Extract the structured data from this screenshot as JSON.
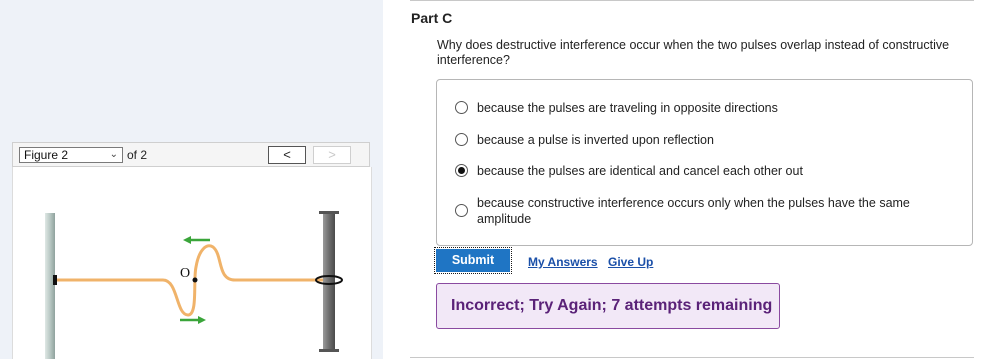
{
  "figure_panel": {
    "select_value": "Figure 2",
    "of_text": "of 2",
    "prev_label": "<",
    "next_label": ">",
    "origin_label": "O",
    "colors": {
      "string": "#f0b36a",
      "arrow": "#3aa53a",
      "wall": "#b9c8c4",
      "pole": "#6e6e6e"
    },
    "icons": {
      "arrow_left": "green-arrow-left-icon",
      "arrow_right": "green-arrow-right-icon"
    }
  },
  "part": {
    "title": "Part C",
    "question": "Why does destructive interference occur when the two pulses overlap instead of constructive interference?",
    "options": [
      {
        "label": "because the pulses are traveling in opposite directions",
        "selected": false
      },
      {
        "label": "because a pulse is inverted upon reflection",
        "selected": false
      },
      {
        "label": "because the pulses are identical and cancel each other out",
        "selected": true
      },
      {
        "label": "because constructive interference occurs only when the pulses have the same amplitude",
        "selected": false
      }
    ],
    "submit_label": "Submit",
    "my_answers_label": "My Answers",
    "give_up_label": "Give Up",
    "feedback": "Incorrect; Try Again; 7 attempts remaining"
  }
}
